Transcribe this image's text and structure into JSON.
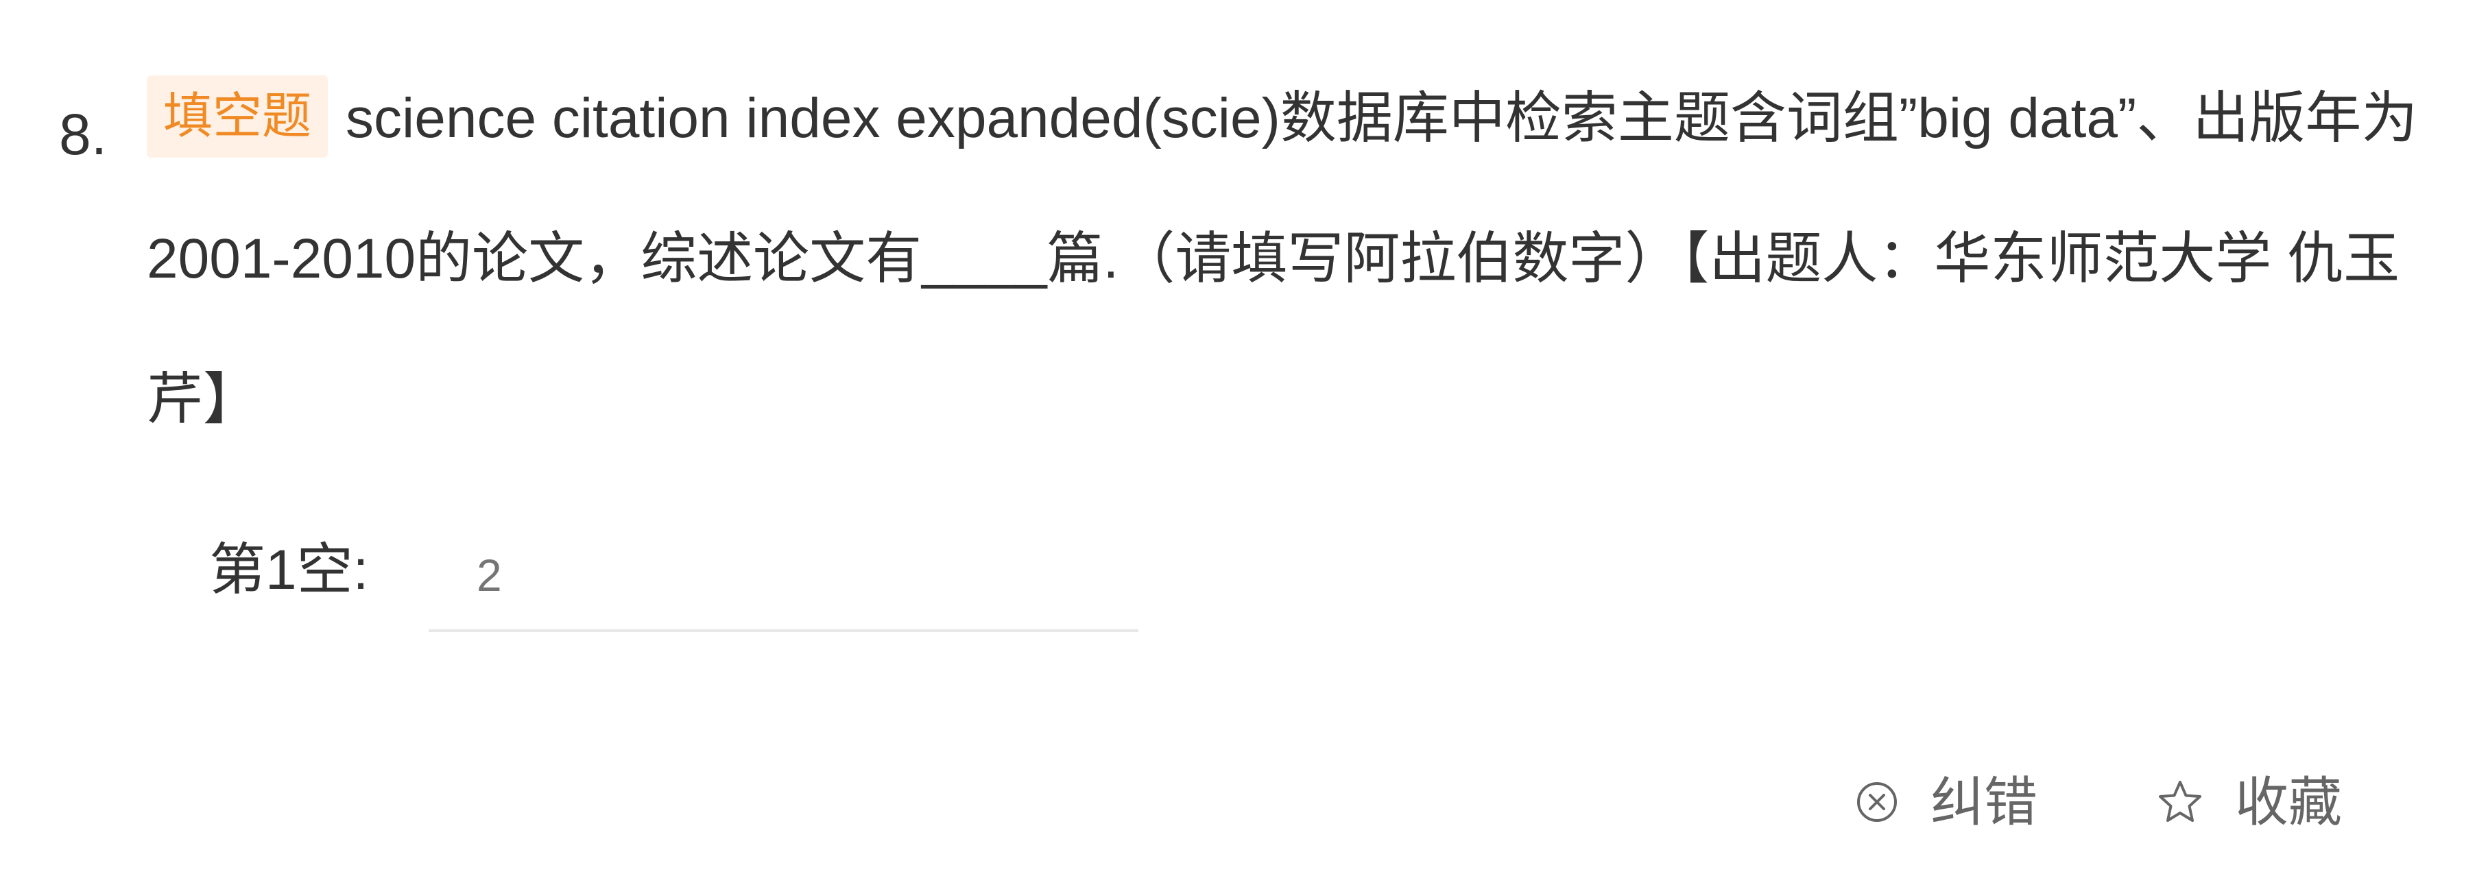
{
  "question": {
    "number": "8.",
    "type_badge": "填空题",
    "text": "science citation index expanded(scie)数据库中检索主题含词组”big data”、出版年为2001-2010的论文，综述论文有____篇.（请填写阿拉伯数字）【出题人：华东师范大学 仇玉芹】"
  },
  "answer": {
    "label": "第1空:",
    "placeholder": "2",
    "value": ""
  },
  "actions": {
    "report_label": "纠错",
    "report_icon": "circle-x-icon",
    "favorite_label": "收藏",
    "favorite_icon": "star-outline-icon"
  },
  "colors": {
    "badge_text": "#f08a24",
    "badge_bg": "#fff1e6",
    "text": "#333333",
    "muted": "#666666",
    "input_line": "#e8e8e8"
  }
}
